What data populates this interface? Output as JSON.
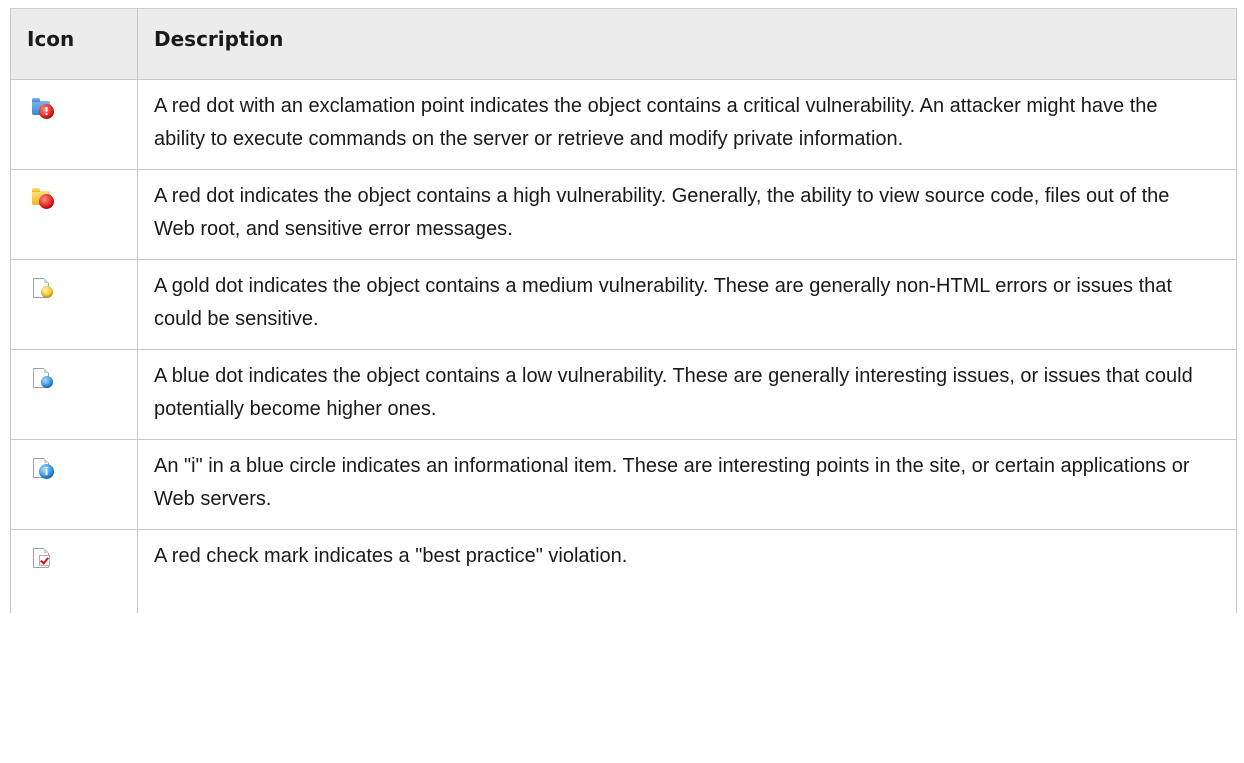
{
  "table": {
    "headers": {
      "icon": "Icon",
      "description": "Description"
    },
    "rows": [
      {
        "icon": "critical-vulnerability-icon",
        "description": "A red dot with an exclamation point indicates the object contains a critical vulnerability. An attacker might have the ability to execute commands on the server or retrieve and modify private information."
      },
      {
        "icon": "high-vulnerability-icon",
        "description": "A red dot indicates the object contains a high vulnerability. Generally, the ability to view source code, files out of the Web root, and sensitive error messages."
      },
      {
        "icon": "medium-vulnerability-icon",
        "description": "A gold dot indicates the object contains a medium vulnerability. These are generally non-HTML errors or issues that could be sensitive."
      },
      {
        "icon": "low-vulnerability-icon",
        "description": "A blue dot indicates the object contains a low vulnerability. These are generally interesting issues, or issues that could potentially become higher ones."
      },
      {
        "icon": "informational-icon",
        "description": "An \"i\" in a blue circle indicates an informational item. These are interesting points in the site, or certain applications or Web servers."
      },
      {
        "icon": "best-practice-violation-icon",
        "description": "A red check mark indicates a \"best practice\" violation."
      }
    ]
  },
  "icon_glyphs": {
    "exclamation": "!",
    "info": "i"
  },
  "colors": {
    "header_bg": "#ececec",
    "border": "#c8c8c8",
    "red_dot": "#e11b1b",
    "gold_dot": "#f2c12e",
    "blue_dot": "#2a8ddc"
  }
}
